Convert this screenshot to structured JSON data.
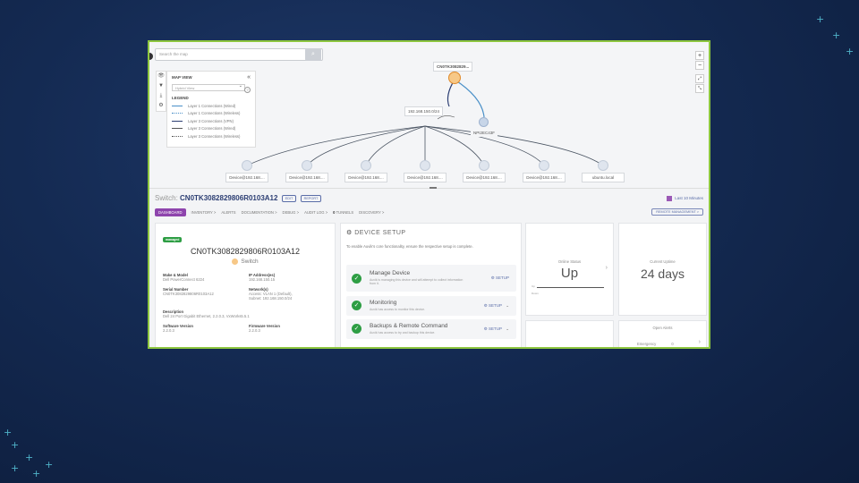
{
  "map": {
    "search_placeholder": "Search the map",
    "map_view_title": "MAP VIEW",
    "view_select": "Hybrid View",
    "legend_title": "LEGEND",
    "legend": [
      {
        "label": "Layer 1 Connections (Wired)",
        "color": "#4a90c8",
        "style": "solid"
      },
      {
        "label": "Layer 1 Connections (Wireless)",
        "color": "#4a90c8",
        "style": "dotted"
      },
      {
        "label": "Layer 3 Connections (VPN)",
        "color": "#2c3e73",
        "style": "solid"
      },
      {
        "label": "Layer 3 Connections (Wired)",
        "color": "#555555",
        "style": "solid"
      },
      {
        "label": "Layer 3 Connections (Wireless)",
        "color": "#555555",
        "style": "dotted"
      }
    ],
    "top_node": "CN0TK3082829...",
    "subnet_node": "192.168.150.0/24",
    "npi_node": "NPI2EC43F",
    "devices": [
      "Device@192.168....",
      "Device@192.168....",
      "Device@192.168....",
      "Device@192.168....",
      "Device@192.168....",
      "Device@192.168....",
      "ubuntu.local"
    ]
  },
  "header": {
    "prefix": "Switch:",
    "name": "CN0TK3082829806R0103A12",
    "edit": "EDIT",
    "report": "REPORT",
    "time_range": "Last 10 Minutes"
  },
  "tabs": {
    "dashboard": "DASHBOARD",
    "inventory": "INVENTORY >",
    "alerts": "ALERTS",
    "documentation": "DOCUMENTATION >",
    "debug": "DEBUG >",
    "audit_log": "AUDIT LOG >",
    "tunnels_count": "0",
    "tunnels": "TUNNELS",
    "discovery": "DISCOVERY >",
    "remote_management": "REMOTE MANAGEMENT >"
  },
  "device": {
    "badge": "managed",
    "name": "CN0TK3082829806R0103A12",
    "type": "Switch",
    "make_model_label": "Make & Model",
    "make_model": "Dell PowerConnect 6224",
    "ip_label": "IP Address(es)",
    "ip": "192.168.150.15",
    "serial_label": "Serial Number",
    "serial": "CN0TK3082829806R0103A12",
    "network_label": "Network(s)",
    "network_line1": "Access: VLAN 1 (Default),",
    "network_line2": "Subnet: 192.168.150.0/24",
    "description_label": "Description",
    "description": "Dell 24 Port Gigabit Ethernet, 2.2.0.3, VxWorks5.5.1",
    "software_label": "Software Version",
    "software": "2.2.0.3",
    "firmware_label": "Firmware Version",
    "firmware": "2.2.0.3"
  },
  "setup": {
    "title": "DEVICE SETUP",
    "note": "To enable Auvik's core functionality, ensure the respective setup is complete.",
    "items": [
      {
        "title": "Manage Device",
        "desc": "Auvik is managing this device and will attempt to collect information from it.",
        "action": "SETUP"
      },
      {
        "title": "Monitoring",
        "desc": "Auvik has access to monitor this device.",
        "action": "SETUP"
      },
      {
        "title": "Backups & Remote Command",
        "desc": "Auvik has access to try and backup this device.",
        "action": "SETUP"
      }
    ]
  },
  "stats": {
    "online_label": "Online Status",
    "online_value": "Up",
    "chart_up": "Up",
    "chart_down": "Down",
    "uptime_label": "Current Uptime",
    "uptime_value": "24 days",
    "alerts_label": "Open Alerts",
    "emergency_label": "Emergency",
    "emergency_count": "0"
  },
  "colors": {
    "accent_purple": "#8e44ad",
    "frame_border": "#8dc63f",
    "success": "#2e9e44",
    "navy": "#2c3e73"
  }
}
